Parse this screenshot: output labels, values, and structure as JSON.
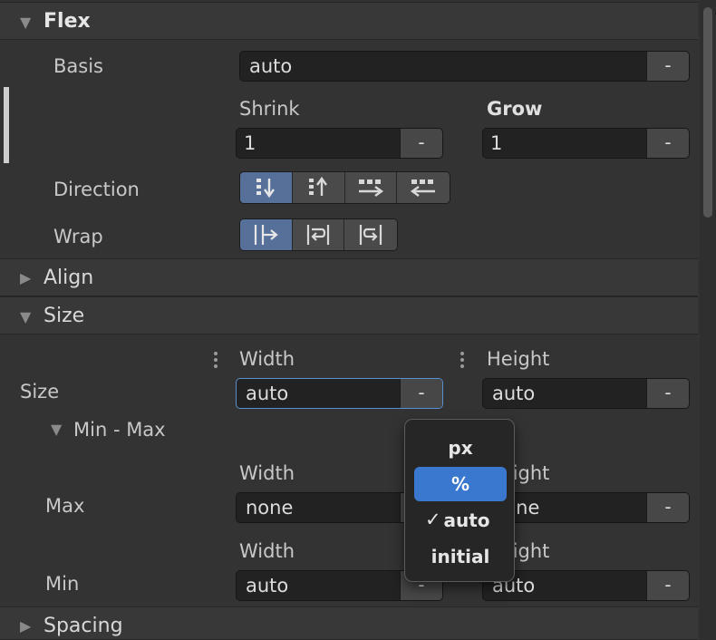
{
  "sections": {
    "flex": "Flex",
    "align": "Align",
    "size": "Size",
    "spacing": "Spacing"
  },
  "flex": {
    "basis_label": "Basis",
    "basis_value": "auto",
    "shrink_label": "Shrink",
    "shrink_value": "1",
    "grow_label": "Grow",
    "grow_value": "1",
    "unit_symbol": "-",
    "direction_label": "Direction",
    "direction_options": [
      "column",
      "column-reverse",
      "row",
      "row-reverse"
    ],
    "direction_selected": "column",
    "wrap_label": "Wrap",
    "wrap_options": [
      "nowrap",
      "wrap",
      "wrap-reverse"
    ],
    "wrap_selected": "nowrap"
  },
  "size": {
    "row_label": "Size",
    "width_label": "Width",
    "height_label": "Height",
    "width_value": "auto",
    "height_value": "auto",
    "minmax_label": "Min - Max",
    "max_label": "Max",
    "max_width_label": "Width",
    "max_height_label": "Height",
    "max_width_value": "none",
    "max_height_value": "none",
    "min_label": "Min",
    "min_width_label": "Width",
    "min_height_label": "Height",
    "min_width_value": "auto",
    "min_height_value": "auto",
    "unit_symbol": "-"
  },
  "unit_menu": {
    "items": [
      "px",
      "%",
      "auto",
      "initial"
    ],
    "highlighted": "%",
    "checked": "auto",
    "check_glyph": "✓"
  }
}
